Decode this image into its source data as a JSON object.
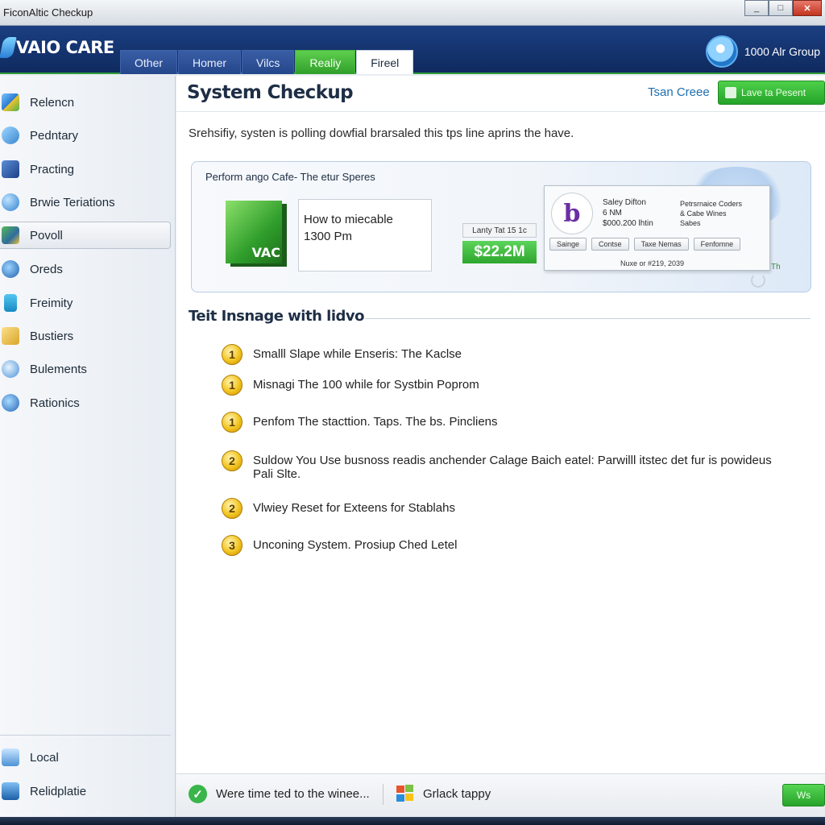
{
  "window": {
    "title": "FiconAltic Checkup",
    "buttons": [
      "_",
      "□",
      "✕"
    ]
  },
  "header": {
    "brand": "VAIO CARE",
    "tabs": [
      "Other",
      "Homer",
      "Vilcs",
      "Realiy",
      "Fireel"
    ],
    "active_tab": "Fireel",
    "group_label": "1000 Alr Group"
  },
  "sidebar": {
    "items": [
      {
        "label": "Relencn",
        "icon": "monitor-grid-icon"
      },
      {
        "label": "Pedntary",
        "icon": "network-icon"
      },
      {
        "label": "Practing",
        "icon": "shield-icon"
      },
      {
        "label": "Brwie Teriations",
        "icon": "globe-icon"
      },
      {
        "label": "Povoll",
        "icon": "tools-icon"
      },
      {
        "label": "Oreds",
        "icon": "world-icon"
      },
      {
        "label": "Freimity",
        "icon": "usb-icon"
      },
      {
        "label": "Bustiers",
        "icon": "folders-icon"
      },
      {
        "label": "Bulements",
        "icon": "search-globe-icon"
      },
      {
        "label": "Rationics",
        "icon": "info-globe-icon"
      }
    ],
    "selected_index": 4,
    "bottom_items": [
      {
        "label": "Local",
        "icon": "computer-icon"
      },
      {
        "label": "Relidplatie",
        "icon": "monitor-icon"
      }
    ]
  },
  "main": {
    "title": "System Checkup",
    "top_link": "Tsan Creee",
    "top_button": "Lave ta Pesent",
    "description": "Srehsifiy, systen is polling dowfial brarsaled this tps line aprins the have.",
    "banner": {
      "title": "Perform ango Cafe- The etur Speres",
      "box_label": "VAC",
      "info_line1": "How to miecable",
      "info_line2": "1300 Pm",
      "price_caption": "Lanty Tat 15 1c",
      "price_value": "$22.2M",
      "popup": {
        "mid_line1": "Saley Difton",
        "mid_line2": "6 NM",
        "mid_line3": "$000.200 lhtin",
        "right_line1": "Petrsrnaice Coders",
        "right_line2": "& Cabe Wines",
        "right_line3": "Sabes",
        "buttons": [
          "Sainge",
          "Contse",
          "Taxe Nemas",
          "Fenfomne"
        ],
        "footer": "Nuxe or #219, 2039"
      },
      "side_text": "Th"
    },
    "section_title": "Teit Insnage with lidvo",
    "tasks": [
      {
        "number": "1",
        "text": "Smalll Slape while Enseris: The Kaclse"
      },
      {
        "number": "1",
        "text": "Misnagi The 100 while for Systbin Poprom"
      },
      {
        "number": "1",
        "text": "Penfom The stacttion. Taps. The bs. Pincliens"
      },
      {
        "number": "2",
        "text": "Suldow You Use busnoss readis anchender Calage Baich eatel: Parwilll itstec det fur is powideus Pali Slte."
      },
      {
        "number": "2",
        "text": "Vlwiey Reset for Exteens for Stablahs"
      },
      {
        "number": "3",
        "text": "Unconing System. Prosiup Ched Letel"
      }
    ]
  },
  "footer": {
    "status": "Were time ted to the winee...",
    "help": "Grlack tappy",
    "button": "Ws"
  }
}
